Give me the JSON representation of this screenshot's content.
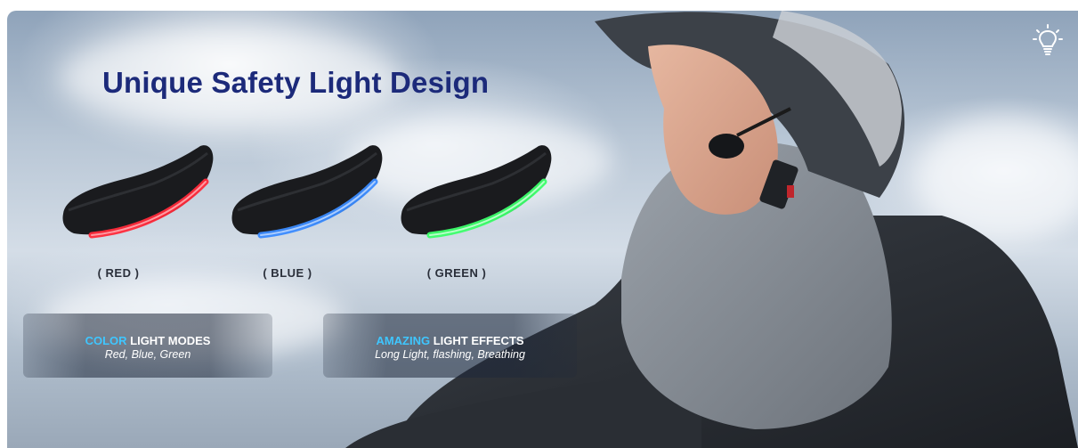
{
  "banner": {
    "title": "Unique Safety Light Design"
  },
  "devices": [
    {
      "label": "( RED )",
      "color": "#ff2a3a"
    },
    {
      "label": "( BLUE )",
      "color": "#3a8bff"
    },
    {
      "label": "( GREEN )",
      "color": "#3cff6a"
    }
  ],
  "features": [
    {
      "accent": "COLOR",
      "title": " LIGHT MODES",
      "subtitle": "Red, Blue, Green"
    },
    {
      "accent": "AMAZING",
      "title": " LIGHT EFFECTS",
      "subtitle": "Long Light, flashing, Breathing"
    }
  ],
  "icons": {
    "corner": "lightbulb-icon"
  },
  "colors": {
    "title": "#1c2a7a",
    "accent": "#3fc6ff"
  }
}
